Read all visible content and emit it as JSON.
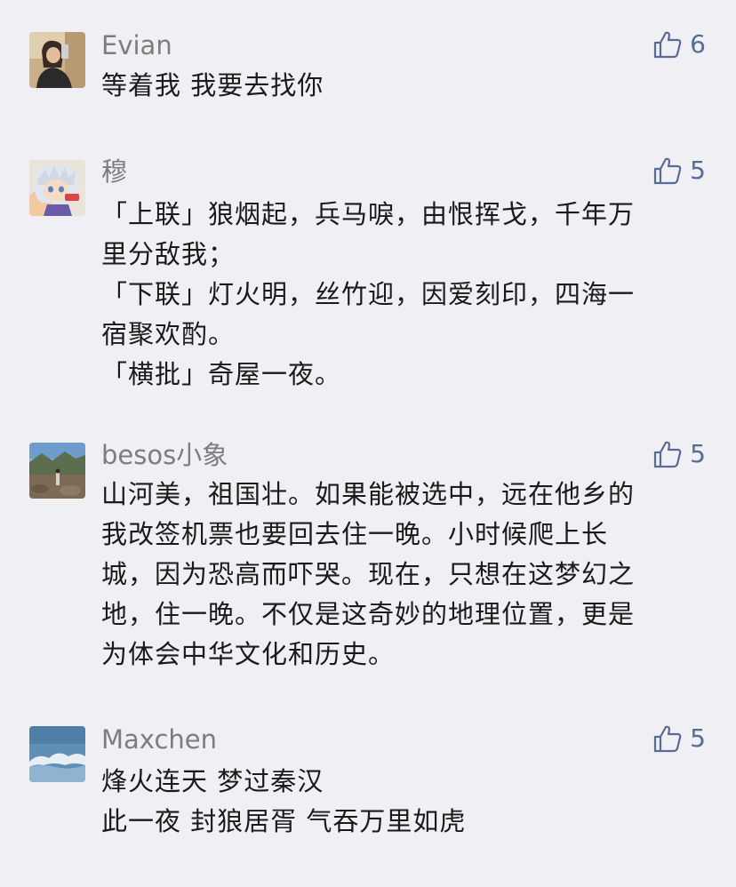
{
  "comments": [
    {
      "username": "Evian",
      "likes": "6",
      "lines": [
        "等着我 我要去找你"
      ]
    },
    {
      "username": "穆",
      "likes": "5",
      "lines": [
        "「上联」狼烟起，兵马唳，由恨挥戈，千年万",
        "里分敌我；",
        "「下联」灯火明，丝竹迎，因爱刻印，四海一",
        "宿聚欢酌。",
        "「横批」奇屋一夜。"
      ]
    },
    {
      "username": "besos小象",
      "likes": "5",
      "lines": [
        "山河美，祖国壮。如果能被选中，远在他乡的",
        "我改签机票也要回去住一晚。小时候爬上长",
        "城，因为恐高而吓哭。现在，只想在这梦幻之",
        "地，住一晚。不仅是这奇妙的地理位置，更是",
        "为体会中华文化和历史。"
      ]
    },
    {
      "username": "Maxchen",
      "likes": "5",
      "lines": [
        "烽火连天 梦过秦汉",
        "此一夜 封狼居胥 气吞万里如虎"
      ]
    }
  ],
  "icons": {
    "like": "thumbs-up-outline-icon"
  },
  "colors": {
    "background": "#efeff4",
    "like_accent": "#576b95",
    "username": "#7d7d7d",
    "body_text": "#1a1a1a"
  }
}
